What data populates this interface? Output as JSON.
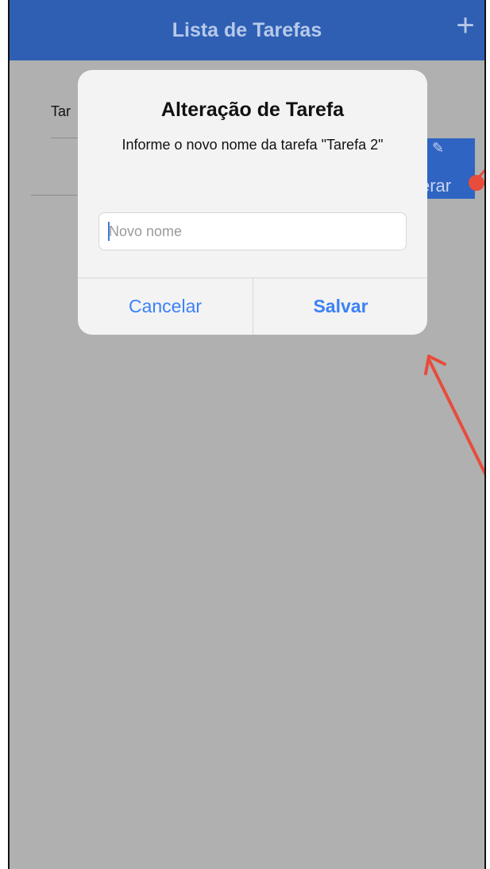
{
  "app": {
    "title": "Lista de Tarefas",
    "add_icon": "plus-icon"
  },
  "list": {
    "row_text": "Tar",
    "action_button": {
      "label": "erar",
      "icon": "pencil-icon"
    }
  },
  "dialog": {
    "title": "Alteração de Tarefa",
    "message": "Informe o novo nome da tarefa \"Tarefa 2\"",
    "input": {
      "value": "",
      "placeholder": "Novo nome"
    },
    "cancel_label": "Cancelar",
    "save_label": "Salvar"
  },
  "colors": {
    "navbar": "#2f5fb3",
    "overlay": "#b0b0b0",
    "action_button": "#2f64c2",
    "dialog_button_text": "#3b82f6",
    "annotation_arrow": "#e74c3c"
  }
}
